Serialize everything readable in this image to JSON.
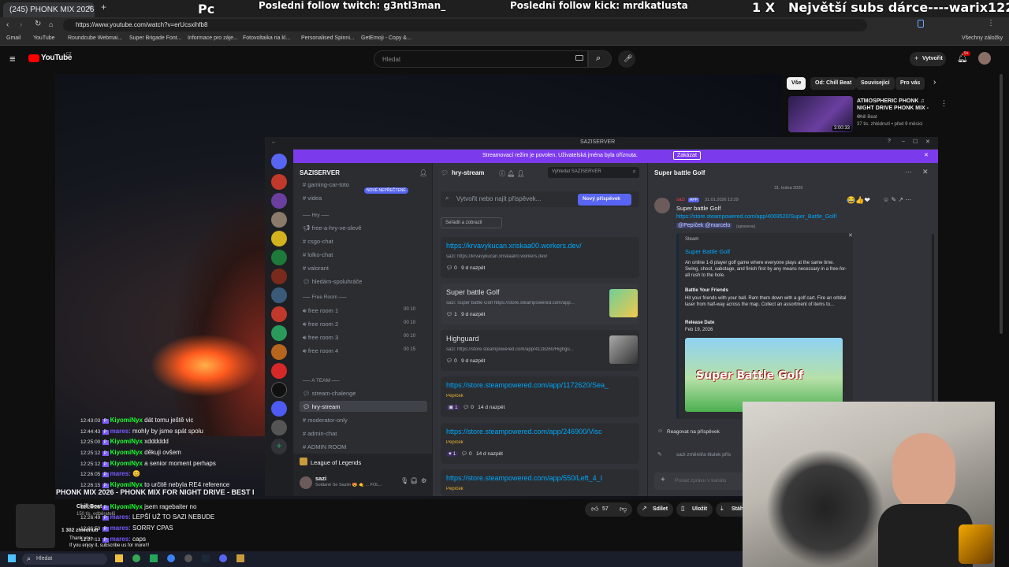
{
  "browser": {
    "tab_title": "(245) PHONK MIX 2026 - P",
    "address": "https://www.youtube.com/watch?v=erUcsxihfb8",
    "new_tab": "+",
    "close_tab": "✕",
    "bookmarks": [
      "Gmail",
      "YouTube",
      "Roundcube Webmai...",
      "Super Brigade Font...",
      "Informace pro záje...",
      "Fotovoltaika na kl...",
      "Personalised Spinni...",
      "GetEmoji - Copy &...",
      "Všechny záložky"
    ]
  },
  "overlay": {
    "pc": "Pc",
    "twitch": "Posledni follow twitch: g3ntl3man_",
    "kick": "Posledni follow kick: mrdkatlusta",
    "count": "1 X",
    "subs": "Největší subs dárce----warix12236"
  },
  "youtube": {
    "logo": "YouTube",
    "logo_badge": "CZ",
    "search_placeholder": "Hledat",
    "create": "Vytvořit",
    "notif_count": "9+",
    "chips": [
      "Vše",
      "Od: Chill Beat",
      "Související",
      "Pro vás"
    ],
    "rec": {
      "title": "ATMOSPHERIC PHONK ♫ NIGHT DRIVE PHONK MIX - ...",
      "channel": "Chill Beat",
      "meta": "37 tis. zhlédnutí • před 9 měsíci",
      "duration": "3:00:33"
    },
    "video_title": "PHONK MIX 2026 - PHONK MIX FOR NIGHT DRIVE - BEST I",
    "channel": "Chill Beat",
    "subs": "150 tis. odběratelů",
    "likes": "57",
    "share": "Sdílet",
    "save": "Uložit",
    "download": "Stáh",
    "views": "1 302 zhlédnutí",
    "desc_line": "Thank you...",
    "desc_line2": "If you enjoy it, subscribe us for more!!!"
  },
  "discord": {
    "window_title": "SAZISERVER",
    "banner_text": "Streamovací režim je povolen. Uživatelská jména byla oříznuta.",
    "banner_button": "Zakázat",
    "server_name": "SAZISERVER",
    "new_unread": "NOVÉ NEPŘEČTENÉ",
    "channels": [
      {
        "label": "gaming-car-toto",
        "type": "#"
      },
      {
        "label": "videa",
        "type": "#"
      },
      {
        "label": "free-a-hry-ve-slevě",
        "type": "📢"
      },
      {
        "label": "csgo-chat",
        "type": "#"
      },
      {
        "label": "lolko-chat",
        "type": "#"
      },
      {
        "label": "valorant",
        "type": "#"
      },
      {
        "label": "hledám-spoluhráče",
        "type": "💬"
      },
      {
        "label": "free room 1",
        "type": "🔊",
        "a": "00",
        "b": "10"
      },
      {
        "label": "free room 2",
        "type": "🔊",
        "a": "00",
        "b": "10"
      },
      {
        "label": "free room 3",
        "type": "🔊",
        "a": "00",
        "b": "10"
      },
      {
        "label": "free room 4",
        "type": "🔊",
        "a": "00",
        "b": "15"
      },
      {
        "label": "stream-chalenge",
        "type": "💬"
      },
      {
        "label": "hry-stream",
        "type": "💬"
      },
      {
        "label": "moderator-only",
        "type": "#"
      },
      {
        "label": "admin-chat",
        "type": "#"
      },
      {
        "label": "ADMIN ROOM",
        "type": "#"
      }
    ],
    "categories": {
      "hry": "Hry",
      "free_room": "Free Room",
      "team": "A TEAM"
    },
    "voice_bar": "League of Legends",
    "user": {
      "name": "sazi",
      "status": "Soldaně Se Sazim 😍 🤙 ... FOL..."
    },
    "forum": {
      "channel": "hry-stream",
      "search_placeholder": "Vyhledat SAZISERVER",
      "create_placeholder": "Vytvořit nebo najít příspěvek...",
      "new_post": "Nový příspěvek",
      "sort": "Seřadit a zobrazit",
      "posts": [
        {
          "title": "https://krvavykucan.xriskaa00.workers.dev/",
          "preview": "sazi: https://krvavykucan.xriskaa00.workers.dev/",
          "count": "0",
          "ago": "9 d nazpět"
        },
        {
          "title": "Super battle Golf",
          "preview": "sazi: Super battle Golf https://store.steampowered.com/app...",
          "count": "1",
          "ago": "9 d nazpět"
        },
        {
          "title": "Highguard",
          "preview": "sazi: https://store.steampowered.com/app/4128260/Highgu...",
          "count": "0",
          "ago": "9 d nazpět"
        },
        {
          "title": "https://store.steampowered.com/app/1172620/Sea_",
          "preview": "Pepíček",
          "reactions": "1",
          "count": "0",
          "ago": "14 d nazpět"
        },
        {
          "title": "https://store.steampowered.com/app/246900/Visc",
          "preview": "Pepíček",
          "reactions": "1",
          "count": "0",
          "ago": "14 d nazpět"
        },
        {
          "title": "https://store.steampowered.com/app/550/Left_4_I",
          "preview": "Pepíček"
        }
      ]
    },
    "thread": {
      "title": "Super battle Golf",
      "date_divider": "31. ledna 2026",
      "author": "sazi",
      "app_badge": "APP",
      "timestamp": "31.01.2026 13:29",
      "message": "Super battle Golf",
      "link": "https://store.steampowered.com/app/4069520/Super_Battle_Golf/",
      "mentions": "@Pepíček @marcelo",
      "edited": "(upraveno)",
      "embed": {
        "provider": "Steam",
        "title": "Super Battle Golf",
        "desc": "An online 1-8 player golf game where everyone plays at the same time. Swing, shoot, sabotage, and finish first by any means necessary in a free-for-all rush to the hole.",
        "h1": "Battle Your Friends",
        "p1": "Hit your friends with your ball. Ram them down with a golf cart. Fire an orbital laser from half-way across the map. Collect an assortment of items to...",
        "h2": "Release Date",
        "p2": "Feb 19, 2026",
        "image_text": "Super Battle Golf"
      },
      "react_label": "Reagovat na příspěvek",
      "system_msg": "sazi změnil/a titulek přís",
      "input_placeholder": "Poslat zprávu v kanálu"
    }
  },
  "chat": [
    {
      "ts": "12:43:03",
      "nick": "KiyomiNyx",
      "color": "#1aff2e",
      "msg": "dát tomu ještě vic"
    },
    {
      "ts": "12:44:43",
      "nick": "mares:",
      "color": "#7b5cff",
      "msg": "mohly by jsme spát spolu"
    },
    {
      "ts": "12:25:00",
      "nick": "KiyomiNyx",
      "color": "#1aff2e",
      "msg": "xdddddd"
    },
    {
      "ts": "12:25:12",
      "nick": "KiyomiNyx",
      "color": "#1aff2e",
      "msg": "děkuji ovšem"
    },
    {
      "ts": "12:25:12",
      "nick": "KiyomiNyx",
      "color": "#1aff2e",
      "msg": "a senior moment perhaps"
    },
    {
      "ts": "12:26:05",
      "nick": "mares:",
      "color": "#7b5cff",
      "msg": "😊"
    },
    {
      "ts": "12:26:15",
      "nick": "KiyomiNyx",
      "color": "#1aff2e",
      "msg": "to určitě nebyla RE4 reference"
    },
    {
      "ts": "12:26:28",
      "nick": "KiyomiNyx",
      "color": "#1aff2e",
      "msg": "jsem ragebaiter no"
    },
    {
      "ts": "12:26:49",
      "nick": "mares:",
      "color": "#7b5cff",
      "msg": "LEPŠÍ UŽ TO SAZI NEBUDE"
    },
    {
      "ts": "12:26:53",
      "nick": "mares:",
      "color": "#7b5cff",
      "msg": "SORRY CPAS"
    },
    {
      "ts": "12:27:13",
      "nick": "mares:",
      "color": "#7b5cff",
      "msg": "caps"
    }
  ],
  "taskbar": {
    "search": "Hledat"
  },
  "colors": {
    "discord_accent": "#7c3aed",
    "link": "#00a8fc",
    "yt_red": "#ff0000"
  }
}
